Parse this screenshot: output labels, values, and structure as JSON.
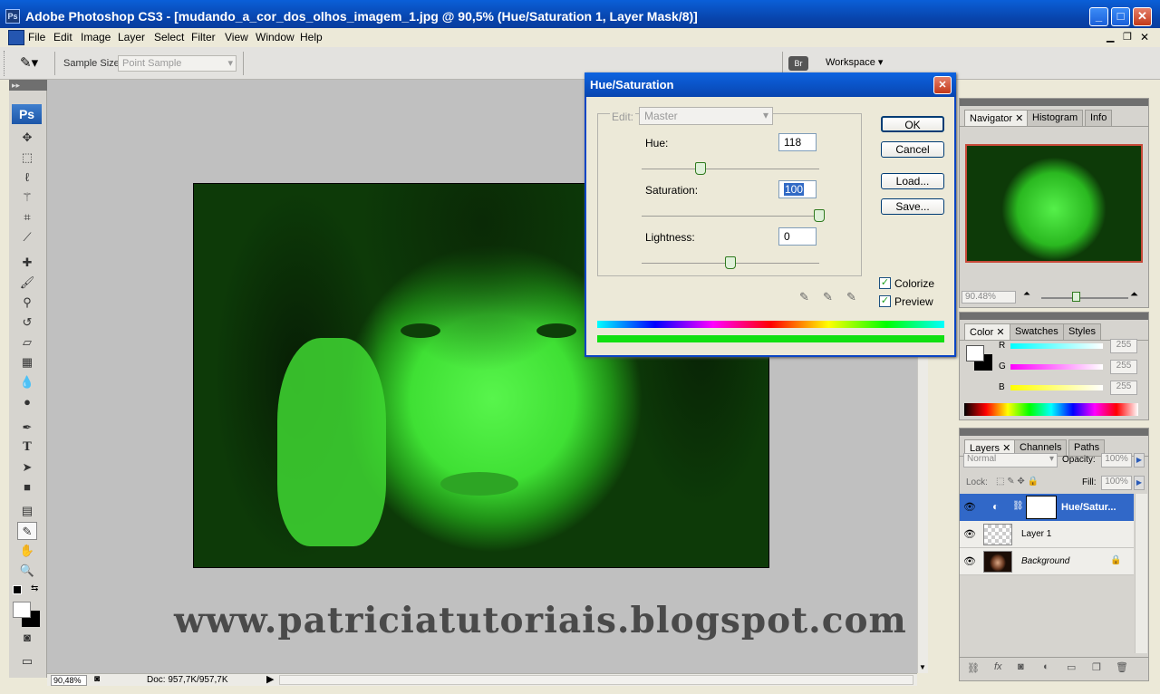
{
  "window": {
    "title": "Adobe Photoshop CS3 - [mudando_a_cor_dos_olhos_imagem_1.jpg @ 90,5% (Hue/Saturation 1, Layer Mask/8)]",
    "app_icon": "Ps"
  },
  "menu": [
    "File",
    "Edit",
    "Image",
    "Layer",
    "Select",
    "Filter",
    "View",
    "Window",
    "Help"
  ],
  "options": {
    "sample_size_label": "Sample Size:",
    "sample_size_value": "Point Sample",
    "workspace_label": "Workspace"
  },
  "toolbox": {
    "logo": "Ps",
    "tools": [
      "move-tool",
      "marquee-tool",
      "lasso-tool",
      "magic-wand-tool",
      "crop-tool",
      "slice-tool",
      "healing-brush-tool",
      "brush-tool",
      "clone-stamp-tool",
      "history-brush-tool",
      "eraser-tool",
      "gradient-tool",
      "blur-tool",
      "dodge-tool",
      "pen-tool",
      "type-tool",
      "path-selection-tool",
      "shape-tool",
      "notes-tool",
      "eyedropper-tool",
      "hand-tool",
      "zoom-tool"
    ],
    "selected_tool": "eyedropper-tool"
  },
  "canvas": {
    "watermark": "www.patriciatutoriais.blogspot.com"
  },
  "status": {
    "zoom": "90,48%",
    "doc": "Doc: 957,7K/957,7K"
  },
  "dialog": {
    "title": "Hue/Saturation",
    "edit_label": "Edit:",
    "edit_value": "Master",
    "hue_label": "Hue:",
    "hue_value": "118",
    "saturation_label": "Saturation:",
    "saturation_value": "100",
    "lightness_label": "Lightness:",
    "lightness_value": "0",
    "hue_level": 0.33,
    "saturation_level": 1.0,
    "lightness_level": 0.5,
    "ok": "OK",
    "cancel": "Cancel",
    "load": "Load...",
    "save": "Save...",
    "colorize": "Colorize",
    "preview": "Preview"
  },
  "navigator": {
    "tabs": [
      "Navigator",
      "Histogram",
      "Info"
    ],
    "zoom": "90.48%"
  },
  "color_panel": {
    "tabs": [
      "Color",
      "Swatches",
      "Styles"
    ],
    "r_label": "R",
    "r_value": "255",
    "g_label": "G",
    "g_value": "255",
    "b_label": "B",
    "b_value": "255"
  },
  "layers_panel": {
    "tabs": [
      "Layers",
      "Channels",
      "Paths"
    ],
    "blend_mode": "Normal",
    "opacity_label": "Opacity:",
    "opacity_value": "100%",
    "lock_label": "Lock:",
    "fill_label": "Fill:",
    "fill_value": "100%",
    "layers": [
      {
        "name": "Hue/Satur...",
        "selected": true
      },
      {
        "name": "Layer 1",
        "selected": false
      },
      {
        "name": "Background",
        "selected": false
      }
    ]
  },
  "colors": {
    "accent": "#0a5fd8",
    "photo_green": "#3fe034",
    "selected_layer": "#3168c8"
  }
}
